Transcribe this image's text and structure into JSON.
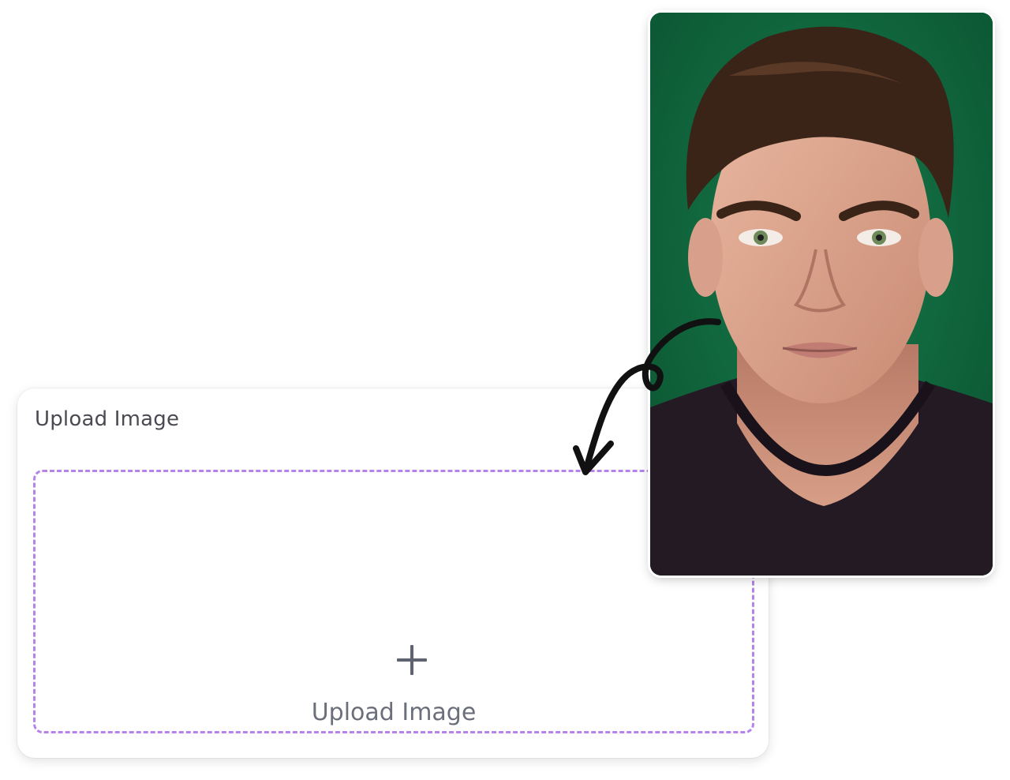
{
  "upload_card": {
    "title": "Upload Image",
    "dropzone": {
      "label": "Upload Image",
      "icon": "plus-icon",
      "border_color": "#b583ea"
    }
  },
  "photo": {
    "background_color": "#0f6a3e",
    "shirt_color": "#241a24"
  },
  "arrow": {
    "icon": "curved-arrow-icon",
    "color": "#111111"
  }
}
